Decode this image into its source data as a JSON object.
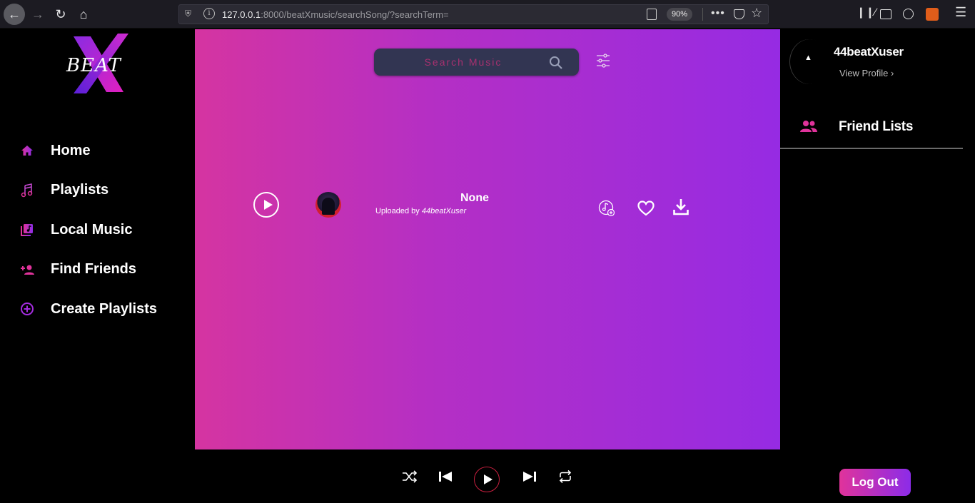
{
  "browser": {
    "url_host": "127.0.0.1",
    "url_rest": ":8000/beatXmusic/searchSong/?searchTerm=",
    "zoom": "90%"
  },
  "logo": {
    "text": "BEAT"
  },
  "sidebar": {
    "items": [
      {
        "label": "Home",
        "icon": "home-icon"
      },
      {
        "label": "Playlists",
        "icon": "music-notes-icon"
      },
      {
        "label": "Local Music",
        "icon": "music-library-icon"
      },
      {
        "label": "Find Friends",
        "icon": "person-add-icon"
      },
      {
        "label": "Create Playlists",
        "icon": "add-circle-icon"
      }
    ]
  },
  "search": {
    "placeholder": "Search Music",
    "value": ""
  },
  "results": [
    {
      "title": "None",
      "uploaded_prefix": "Uploaded by",
      "uploader": "44beatXuser"
    }
  ],
  "profile": {
    "username": "44beatXuser",
    "view_profile": "View Profile ›"
  },
  "friends": {
    "title": "Friend Lists"
  },
  "player": {
    "logout": "Log Out"
  },
  "colors": {
    "gradient_start": "#d534a1",
    "gradient_end": "#962be3",
    "accent_pink": "#e0339b",
    "accent_purple": "#8c2ce8",
    "search_bg": "#323552"
  }
}
